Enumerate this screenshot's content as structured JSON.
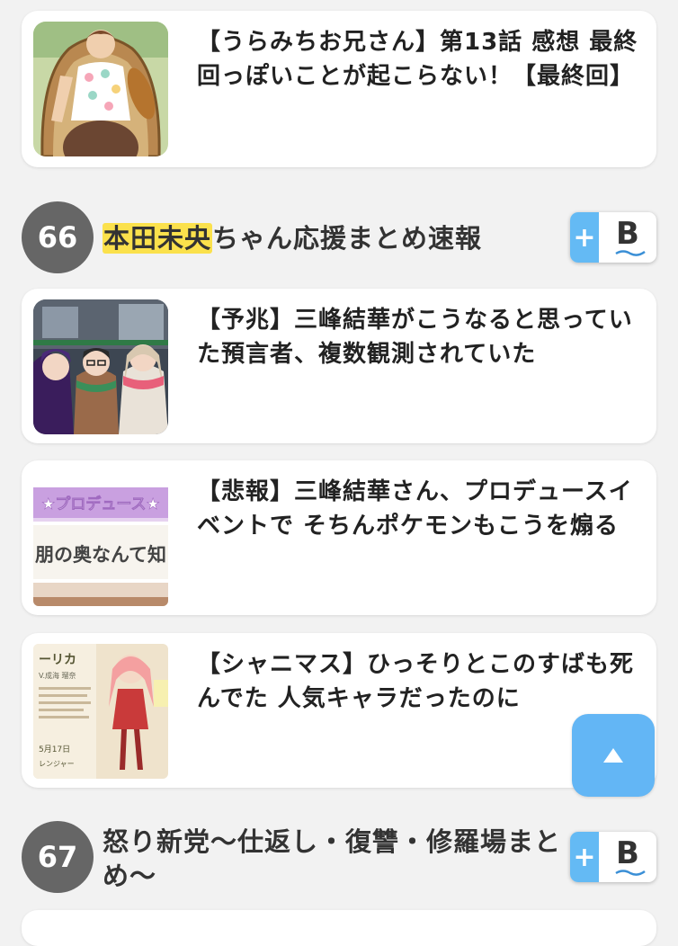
{
  "articles": [
    {
      "title": "【うらみちお兄さん】第13話 感想 最終回っぽいことが起こらない！【最終回】"
    },
    {
      "title": "【予兆】三峰結華がこうなると思っていた預言者、複数観測されていた"
    },
    {
      "title": "【悲報】三峰結華さん、プロデュースイベントで そちんポケモンもこうを煽る"
    },
    {
      "title": "【シャニマス】ひっそりとこのすばも死んでた 人気キャラだったのに"
    }
  ],
  "sites": [
    {
      "rank": "66",
      "name_highlight": "本田未央",
      "name_rest": "ちゃん応援まとめ速報"
    },
    {
      "rank": "67",
      "name": "怒り新党〜仕返し・復讐・修羅場まとめ〜"
    }
  ],
  "hatena": {
    "plus": "+",
    "letter": "B"
  },
  "thumbnails": {
    "promo_banner_text": "★プロデュース★",
    "promo_sub_text": "朋の奥なんて知らな",
    "card_name": "ーリカ",
    "card_cv": "V.成海 瑠奈",
    "card_date": "5月17日",
    "card_footer": "レンジャー"
  },
  "colors": {
    "accent": "#63b6f5",
    "highlight": "#fbe14c",
    "rank_badge": "#666666"
  }
}
